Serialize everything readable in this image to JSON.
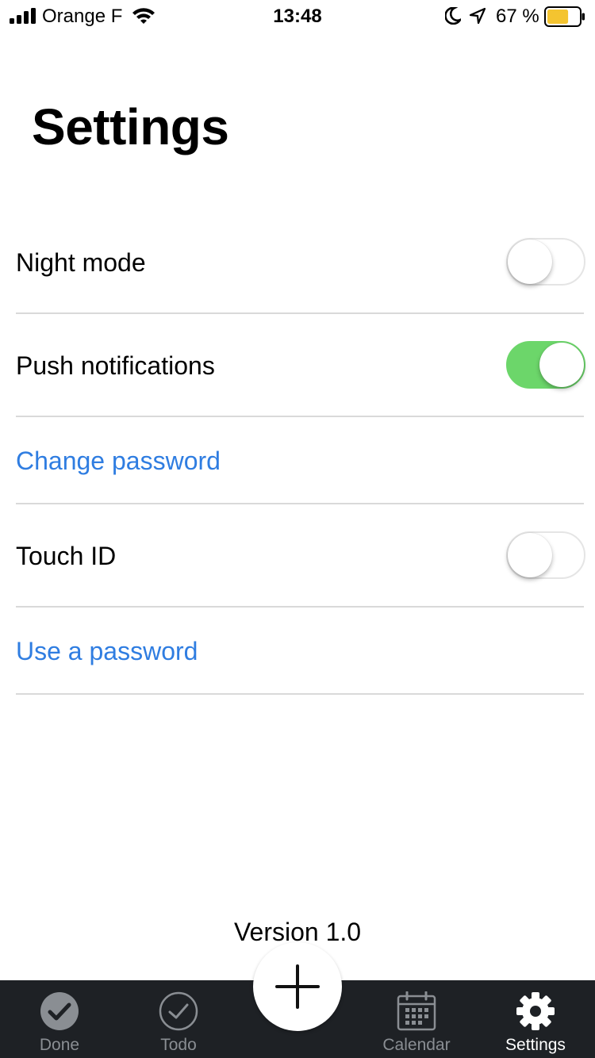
{
  "status_bar": {
    "carrier": "Orange F",
    "time": "13:48",
    "battery_percent": "67 %",
    "battery_level": 0.67,
    "battery_color": "#f4c430",
    "icons": [
      "signal-bars-icon",
      "wifi-icon",
      "moon-icon",
      "location-arrow-icon",
      "battery-icon"
    ]
  },
  "page": {
    "title": "Settings"
  },
  "settings": {
    "night_mode": {
      "label": "Night mode",
      "enabled": false
    },
    "push_notifications": {
      "label": "Push notifications",
      "enabled": true
    },
    "change_password": {
      "label": "Change password"
    },
    "touch_id": {
      "label": "Touch ID",
      "enabled": false
    },
    "use_password": {
      "label": "Use a password"
    }
  },
  "footer": {
    "version": "Version 1.0"
  },
  "tab_bar": {
    "tabs": [
      {
        "label": "Done",
        "icon": "check-filled-icon",
        "active": false
      },
      {
        "label": "Todo",
        "icon": "check-outline-icon",
        "active": false
      },
      {
        "label": "Calendar",
        "icon": "calendar-icon",
        "active": false
      },
      {
        "label": "Settings",
        "icon": "gear-icon",
        "active": true
      }
    ],
    "add_icon": "plus-icon"
  },
  "colors": {
    "link": "#2f7de1",
    "toggle_on": "#6cd66a",
    "tab_bar_background": "#1e2125",
    "tab_inactive": "#8a8e93",
    "tab_active": "#ffffff",
    "divider": "#d9d9d9"
  }
}
